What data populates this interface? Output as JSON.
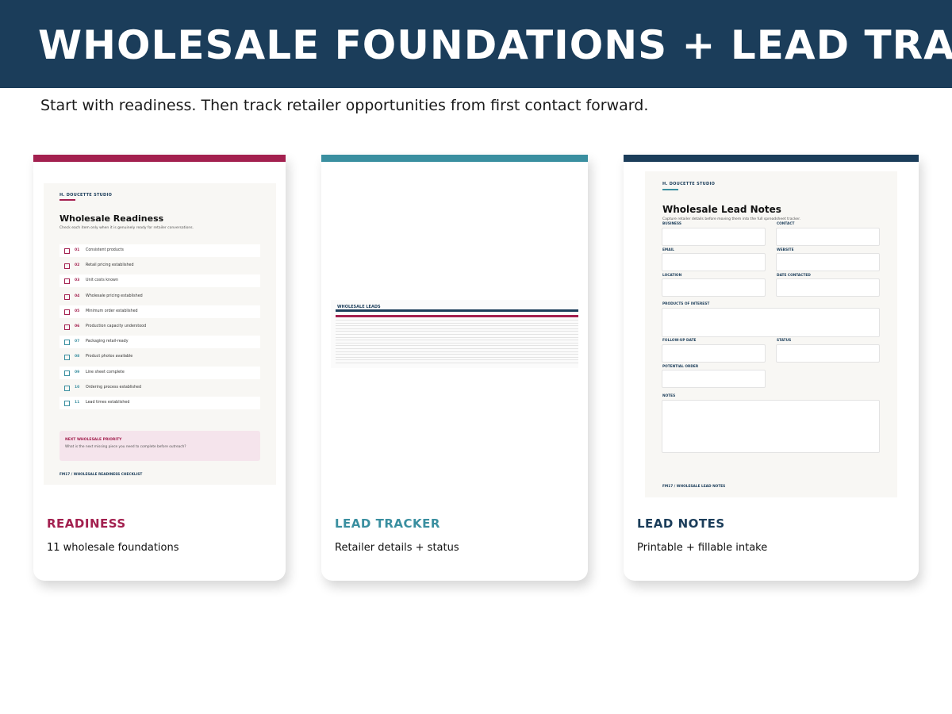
{
  "header": {
    "title": "WHOLESALE FOUNDATIONS + LEAD TRACKING"
  },
  "subtitle": "Start with readiness. Then track retailer opportunities from first contact forward.",
  "colors": {
    "navy": "#1b3d5a",
    "crimson": "#a3204f",
    "teal": "#3a8fa0"
  },
  "cards": [
    {
      "label": "READINESS",
      "description": "11 wholesale foundations",
      "preview": {
        "brand": "H. DOUCETTE STUDIO",
        "title": "Wholesale Readiness",
        "subtitle": "Check each item only when it is genuinely ready for retailer conversations.",
        "items": [
          {
            "num": "01",
            "text": "Consistent products"
          },
          {
            "num": "02",
            "text": "Retail pricing established"
          },
          {
            "num": "03",
            "text": "Unit costs known"
          },
          {
            "num": "04",
            "text": "Wholesale pricing established"
          },
          {
            "num": "05",
            "text": "Minimum order established"
          },
          {
            "num": "06",
            "text": "Production capacity understood"
          },
          {
            "num": "07",
            "text": "Packaging retail-ready"
          },
          {
            "num": "08",
            "text": "Product photos available"
          },
          {
            "num": "09",
            "text": "Line sheet complete"
          },
          {
            "num": "10",
            "text": "Ordering process established"
          },
          {
            "num": "11",
            "text": "Lead times established"
          }
        ],
        "priority_title": "NEXT WHOLESALE PRIORITY",
        "priority_question": "What is the next missing piece you need to complete before outreach?",
        "footer": "FM17 / WHOLESALE READINESS CHECKLIST"
      }
    },
    {
      "label": "LEAD TRACKER",
      "description": "Retailer details + status",
      "preview": {
        "sheet_title": "WHOLESALE LEADS"
      }
    },
    {
      "label": "LEAD NOTES",
      "description": "Printable + fillable intake",
      "preview": {
        "brand": "H. DOUCETTE STUDIO",
        "title": "Wholesale Lead Notes",
        "subtitle": "Capture retailer details before moving them into the full spreadsheet tracker.",
        "fields": {
          "business": "BUSINESS",
          "contact": "CONTACT",
          "email": "EMAIL",
          "website": "WEBSITE",
          "location": "LOCATION",
          "date_contacted": "DATE CONTACTED",
          "products": "PRODUCTS OF INTEREST",
          "follow_up": "FOLLOW-UP DATE",
          "status": "STATUS",
          "potential_order": "POTENTIAL ORDER",
          "notes": "NOTES"
        },
        "footer": "FM17 / WHOLESALE LEAD NOTES"
      }
    }
  ]
}
